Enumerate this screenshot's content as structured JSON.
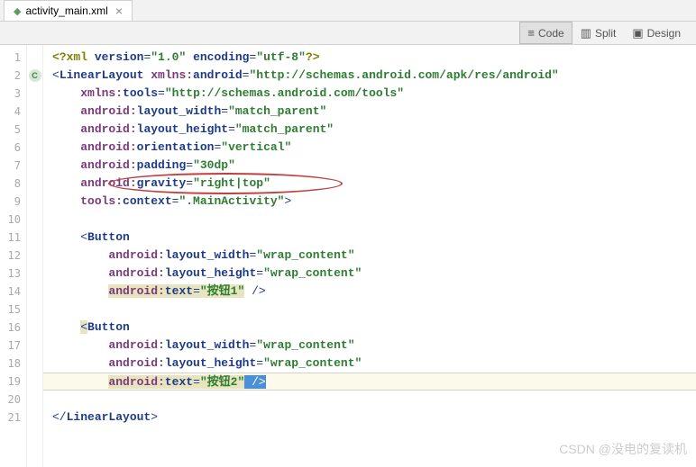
{
  "tab": {
    "filename": "activity_main.xml"
  },
  "viewButtons": {
    "code": "Code",
    "split": "Split",
    "design": "Design"
  },
  "lines": {
    "l1": {
      "pi_open": "<?",
      "pi_name": "xml ",
      "a1": "version",
      "v1": "\"1.0\"",
      "a2": " encoding",
      "v2": "\"utf-8\"",
      "pi_close": "?>"
    },
    "l2": {
      "open": "<",
      "tag": "LinearLayout ",
      "ns": "xmlns:",
      "attr": "android",
      "eq": "=",
      "val": "\"http://schemas.android.com/apk/res/android\""
    },
    "l3": {
      "ns": "xmlns:",
      "attr": "tools",
      "eq": "=",
      "val": "\"http://schemas.android.com/tools\""
    },
    "l4": {
      "ns": "android:",
      "attr": "layout_width",
      "eq": "=",
      "val": "\"match_parent\""
    },
    "l5": {
      "ns": "android:",
      "attr": "layout_height",
      "eq": "=",
      "val": "\"match_parent\""
    },
    "l6": {
      "ns": "android:",
      "attr": "orientation",
      "eq": "=",
      "val": "\"vertical\""
    },
    "l7": {
      "ns": "android:",
      "attr": "padding",
      "eq": "=",
      "val": "\"30dp\""
    },
    "l8": {
      "ns": "android:",
      "attr": "gravity",
      "eq": "=",
      "val": "\"right|top\""
    },
    "l9": {
      "ns": "tools:",
      "attr": "context",
      "eq": "=",
      "val": "\".MainActivity\"",
      "close": ">"
    },
    "l11": {
      "open": "<",
      "tag": "Button"
    },
    "l12": {
      "ns": "android:",
      "attr": "layout_width",
      "eq": "=",
      "val": "\"wrap_content\""
    },
    "l13": {
      "ns": "android:",
      "attr": "layout_height",
      "eq": "=",
      "val": "\"wrap_content\""
    },
    "l14": {
      "ns": "android:",
      "attr": "text",
      "eq": "=",
      "val": "\"按钮1\"",
      "close": " />"
    },
    "l16": {
      "open": "<",
      "tag": "Button"
    },
    "l17": {
      "ns": "android:",
      "attr": "layout_width",
      "eq": "=",
      "val": "\"wrap_content\""
    },
    "l18": {
      "ns": "android:",
      "attr": "layout_height",
      "eq": "=",
      "val": "\"wrap_content\""
    },
    "l19": {
      "ns": "android:",
      "attr": "text",
      "eq": "=",
      "val": "\"按钮2\"",
      "close": " />"
    },
    "l21": {
      "open": "</",
      "tag": "LinearLayout",
      "close": ">"
    }
  },
  "lineNumbers": [
    "1",
    "2",
    "3",
    "4",
    "5",
    "6",
    "7",
    "8",
    "9",
    "10",
    "11",
    "12",
    "13",
    "14",
    "15",
    "16",
    "17",
    "18",
    "19",
    "20",
    "21"
  ],
  "gutterIcon": "C",
  "watermark": "CSDN @没电的复读机"
}
